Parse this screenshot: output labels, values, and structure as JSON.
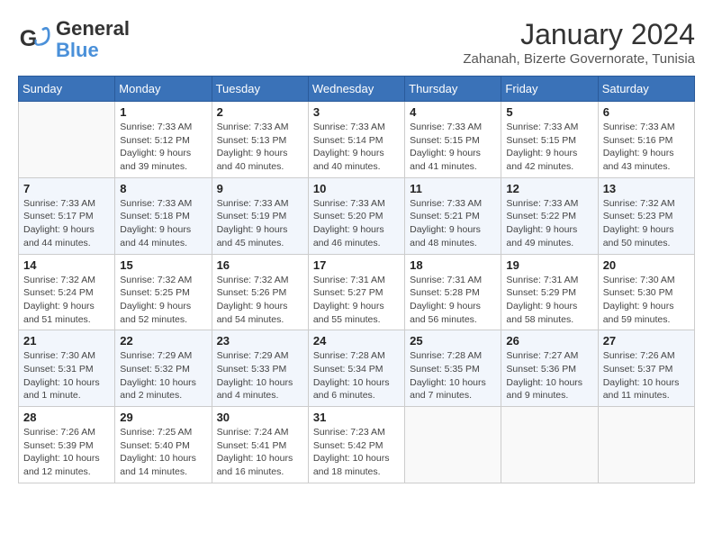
{
  "header": {
    "logo_general": "General",
    "logo_blue": "Blue",
    "main_title": "January 2024",
    "subtitle": "Zahanah, Bizerte Governorate, Tunisia"
  },
  "days_of_week": [
    "Sunday",
    "Monday",
    "Tuesday",
    "Wednesday",
    "Thursday",
    "Friday",
    "Saturday"
  ],
  "weeks": [
    [
      {
        "day": "",
        "info": ""
      },
      {
        "day": "1",
        "info": "Sunrise: 7:33 AM\nSunset: 5:12 PM\nDaylight: 9 hours\nand 39 minutes."
      },
      {
        "day": "2",
        "info": "Sunrise: 7:33 AM\nSunset: 5:13 PM\nDaylight: 9 hours\nand 40 minutes."
      },
      {
        "day": "3",
        "info": "Sunrise: 7:33 AM\nSunset: 5:14 PM\nDaylight: 9 hours\nand 40 minutes."
      },
      {
        "day": "4",
        "info": "Sunrise: 7:33 AM\nSunset: 5:15 PM\nDaylight: 9 hours\nand 41 minutes."
      },
      {
        "day": "5",
        "info": "Sunrise: 7:33 AM\nSunset: 5:15 PM\nDaylight: 9 hours\nand 42 minutes."
      },
      {
        "day": "6",
        "info": "Sunrise: 7:33 AM\nSunset: 5:16 PM\nDaylight: 9 hours\nand 43 minutes."
      }
    ],
    [
      {
        "day": "7",
        "info": "Sunrise: 7:33 AM\nSunset: 5:17 PM\nDaylight: 9 hours\nand 44 minutes."
      },
      {
        "day": "8",
        "info": "Sunrise: 7:33 AM\nSunset: 5:18 PM\nDaylight: 9 hours\nand 44 minutes."
      },
      {
        "day": "9",
        "info": "Sunrise: 7:33 AM\nSunset: 5:19 PM\nDaylight: 9 hours\nand 45 minutes."
      },
      {
        "day": "10",
        "info": "Sunrise: 7:33 AM\nSunset: 5:20 PM\nDaylight: 9 hours\nand 46 minutes."
      },
      {
        "day": "11",
        "info": "Sunrise: 7:33 AM\nSunset: 5:21 PM\nDaylight: 9 hours\nand 48 minutes."
      },
      {
        "day": "12",
        "info": "Sunrise: 7:33 AM\nSunset: 5:22 PM\nDaylight: 9 hours\nand 49 minutes."
      },
      {
        "day": "13",
        "info": "Sunrise: 7:32 AM\nSunset: 5:23 PM\nDaylight: 9 hours\nand 50 minutes."
      }
    ],
    [
      {
        "day": "14",
        "info": "Sunrise: 7:32 AM\nSunset: 5:24 PM\nDaylight: 9 hours\nand 51 minutes."
      },
      {
        "day": "15",
        "info": "Sunrise: 7:32 AM\nSunset: 5:25 PM\nDaylight: 9 hours\nand 52 minutes."
      },
      {
        "day": "16",
        "info": "Sunrise: 7:32 AM\nSunset: 5:26 PM\nDaylight: 9 hours\nand 54 minutes."
      },
      {
        "day": "17",
        "info": "Sunrise: 7:31 AM\nSunset: 5:27 PM\nDaylight: 9 hours\nand 55 minutes."
      },
      {
        "day": "18",
        "info": "Sunrise: 7:31 AM\nSunset: 5:28 PM\nDaylight: 9 hours\nand 56 minutes."
      },
      {
        "day": "19",
        "info": "Sunrise: 7:31 AM\nSunset: 5:29 PM\nDaylight: 9 hours\nand 58 minutes."
      },
      {
        "day": "20",
        "info": "Sunrise: 7:30 AM\nSunset: 5:30 PM\nDaylight: 9 hours\nand 59 minutes."
      }
    ],
    [
      {
        "day": "21",
        "info": "Sunrise: 7:30 AM\nSunset: 5:31 PM\nDaylight: 10 hours\nand 1 minute."
      },
      {
        "day": "22",
        "info": "Sunrise: 7:29 AM\nSunset: 5:32 PM\nDaylight: 10 hours\nand 2 minutes."
      },
      {
        "day": "23",
        "info": "Sunrise: 7:29 AM\nSunset: 5:33 PM\nDaylight: 10 hours\nand 4 minutes."
      },
      {
        "day": "24",
        "info": "Sunrise: 7:28 AM\nSunset: 5:34 PM\nDaylight: 10 hours\nand 6 minutes."
      },
      {
        "day": "25",
        "info": "Sunrise: 7:28 AM\nSunset: 5:35 PM\nDaylight: 10 hours\nand 7 minutes."
      },
      {
        "day": "26",
        "info": "Sunrise: 7:27 AM\nSunset: 5:36 PM\nDaylight: 10 hours\nand 9 minutes."
      },
      {
        "day": "27",
        "info": "Sunrise: 7:26 AM\nSunset: 5:37 PM\nDaylight: 10 hours\nand 11 minutes."
      }
    ],
    [
      {
        "day": "28",
        "info": "Sunrise: 7:26 AM\nSunset: 5:39 PM\nDaylight: 10 hours\nand 12 minutes."
      },
      {
        "day": "29",
        "info": "Sunrise: 7:25 AM\nSunset: 5:40 PM\nDaylight: 10 hours\nand 14 minutes."
      },
      {
        "day": "30",
        "info": "Sunrise: 7:24 AM\nSunset: 5:41 PM\nDaylight: 10 hours\nand 16 minutes."
      },
      {
        "day": "31",
        "info": "Sunrise: 7:23 AM\nSunset: 5:42 PM\nDaylight: 10 hours\nand 18 minutes."
      },
      {
        "day": "",
        "info": ""
      },
      {
        "day": "",
        "info": ""
      },
      {
        "day": "",
        "info": ""
      }
    ]
  ]
}
